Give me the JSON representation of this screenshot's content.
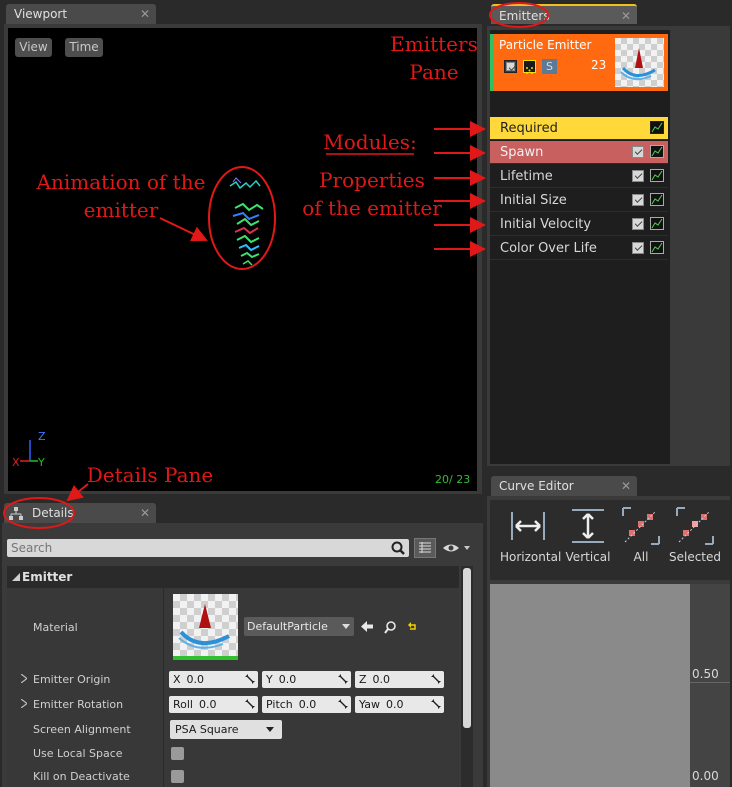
{
  "viewport": {
    "tab_label": "Viewport",
    "view_button": "View",
    "time_button": "Time",
    "axis_z": "Z",
    "axis_x": "X",
    "axis_y": "Y",
    "counter": "20/ 23"
  },
  "emitters": {
    "tab_label": "Emitters",
    "emitter_name": "Particle Emitter",
    "solo_label": "S",
    "particle_count": "23",
    "modules": [
      {
        "label": "Required"
      },
      {
        "label": "Spawn"
      },
      {
        "label": "Lifetime"
      },
      {
        "label": "Initial Size"
      },
      {
        "label": "Initial Velocity"
      },
      {
        "label": "Color Over Life"
      }
    ]
  },
  "curve_editor": {
    "tab_label": "Curve Editor",
    "buttons": [
      "Horizontal",
      "Vertical",
      "All",
      "Selected"
    ],
    "axis_labels": [
      "0.50",
      "0.00"
    ]
  },
  "details": {
    "tab_label": "Details",
    "search_placeholder": "Search",
    "section_title": "Emitter",
    "material_label": "Material",
    "material_value": "DefaultParticle",
    "origin_label": "Emitter Origin",
    "origin": {
      "x_label": "X",
      "x": "0.0",
      "y_label": "Y",
      "y": "0.0",
      "z_label": "Z",
      "z": "0.0"
    },
    "rotation_label": "Emitter Rotation",
    "rotation": {
      "roll_label": "Roll",
      "roll": "0.0",
      "pitch_label": "Pitch",
      "pitch": "0.0",
      "yaw_label": "Yaw",
      "yaw": "0.0"
    },
    "screen_alignment_label": "Screen Alignment",
    "screen_alignment_value": "PSA Square",
    "use_local_space_label": "Use Local Space",
    "kill_on_deactivate_label": "Kill on Deactivate"
  },
  "annotations": {
    "emitters_pane_line1": "Emitters",
    "emitters_pane_line2": "Pane",
    "modules": "Modules:",
    "properties_line1": "Properties",
    "properties_line2": "of the emitter",
    "animation_line1": "Animation of the",
    "animation_line2": "emitter",
    "details_pane": "Details Pane"
  },
  "colors": {
    "emitter_header": "#ff6a10",
    "required_module": "#ffd83a",
    "spawn_module": "#c86060",
    "annotation_red": "#e01818"
  }
}
